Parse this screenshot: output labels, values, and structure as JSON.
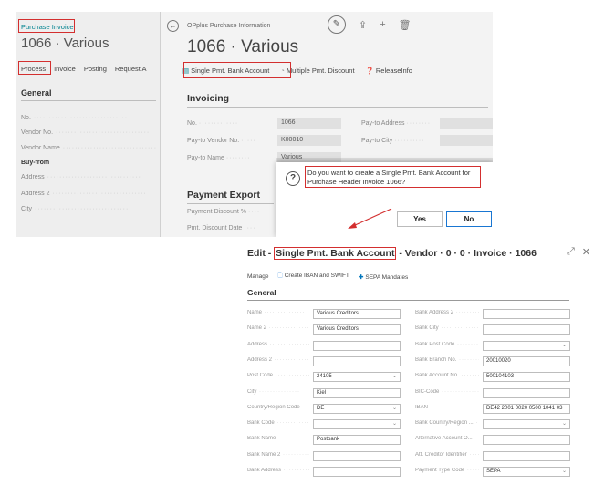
{
  "bg_card": {
    "crumb": "Purchase Invoice",
    "title": "1066 · Various",
    "actions": [
      "Process",
      "Invoice",
      "Posting",
      "Request A"
    ],
    "section": "General",
    "fields": [
      {
        "label": "No.",
        "strong": false
      },
      {
        "label": "Vendor No.",
        "strong": false
      },
      {
        "label": "Vendor Name",
        "strong": false
      },
      {
        "label": "Buy-from",
        "strong": true
      },
      {
        "label": "Address",
        "strong": false
      },
      {
        "label": "Address 2",
        "strong": false
      },
      {
        "label": "City",
        "strong": false
      }
    ]
  },
  "fg_card": {
    "crumb": "OPplus Purchase Information",
    "title": "1066 · Various",
    "actions": [
      "Single Pmt. Bank Account",
      "Multiple Pmt. Discount",
      "ReleaseInfo"
    ],
    "section_invoicing": "Invoicing",
    "section_payment": "Payment Export",
    "fields_left": [
      {
        "label": "No.",
        "value": "1066"
      },
      {
        "label": "Pay-to Vendor No.",
        "value": "K00010"
      },
      {
        "label": "Pay-to Name",
        "value": "Various"
      }
    ],
    "fields_right": [
      {
        "label": "Pay-to Address"
      },
      {
        "label": "Pay-to City"
      }
    ],
    "payment_fields": [
      "Payment Discount %",
      "Pmt. Discount Date"
    ]
  },
  "dialog": {
    "message": "Do you want to create a Single Pmt. Bank Account for Purchase Header Invoice 1066?",
    "yes": "Yes",
    "no": "No"
  },
  "edit": {
    "title_prefix": "Edit - ",
    "title_highlight": "Single Pmt. Bank Account",
    "title_suffix": " - Vendor · 0 · 0 · Invoice · 1066",
    "actions": [
      "Manage",
      "Create IBAN and SWIFT",
      "SEPA Mandates"
    ],
    "section": "General",
    "left_fields": [
      {
        "label": "Name",
        "value": "Various Creditors",
        "dropdown": false
      },
      {
        "label": "Name 2",
        "value": "Various Creditors",
        "dropdown": false
      },
      {
        "label": "Address",
        "value": "",
        "dropdown": false
      },
      {
        "label": "Address 2",
        "value": "",
        "dropdown": false
      },
      {
        "label": "Post Code",
        "value": "24105",
        "dropdown": true
      },
      {
        "label": "City",
        "value": "Kiel",
        "dropdown": false
      },
      {
        "label": "Country/Region Code",
        "value": "DE",
        "dropdown": true
      },
      {
        "label": "Bank Code",
        "value": "",
        "dropdown": true
      },
      {
        "label": "Bank Name",
        "value": "Postbank",
        "dropdown": false
      },
      {
        "label": "Bank Name 2",
        "value": "",
        "dropdown": false
      },
      {
        "label": "Bank Address",
        "value": "",
        "dropdown": false
      }
    ],
    "right_fields": [
      {
        "label": "Bank Address 2",
        "value": "",
        "dropdown": false
      },
      {
        "label": "Bank City",
        "value": "",
        "dropdown": false
      },
      {
        "label": "Bank Post Code",
        "value": "",
        "dropdown": true
      },
      {
        "label": "Bank Branch No.",
        "value": "20010020",
        "dropdown": false
      },
      {
        "label": "Bank Account No.",
        "value": "500104103",
        "dropdown": false
      },
      {
        "label": "BIC-Code",
        "value": "",
        "dropdown": false
      },
      {
        "label": "IBAN",
        "value": "DE42 2001 0020 0500 1041 03",
        "dropdown": false
      },
      {
        "label": "Bank Country/Region ...",
        "value": "",
        "dropdown": true
      },
      {
        "label": "Alternative Account O...",
        "value": "",
        "dropdown": false
      },
      {
        "label": "Att. Creditor Identifier",
        "value": "",
        "dropdown": false
      },
      {
        "label": "Payment Type Code",
        "value": "SEPA",
        "dropdown": true
      }
    ]
  }
}
